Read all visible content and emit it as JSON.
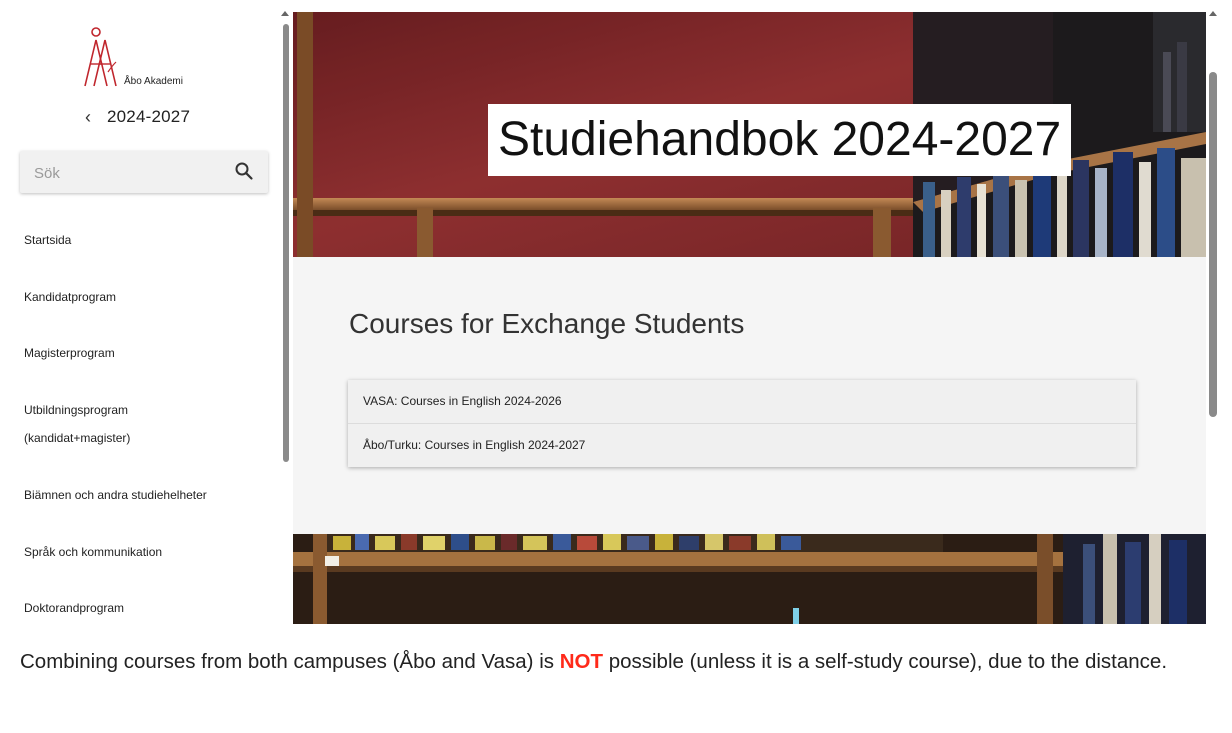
{
  "sidebar": {
    "logo_text": "Åbo Akademi",
    "year": "2024-2027",
    "search_placeholder": "Sök",
    "items": [
      {
        "label": "Startsida"
      },
      {
        "label": "Kandidatprogram"
      },
      {
        "label": "Magisterprogram"
      },
      {
        "label": "Utbildningsprogram"
      },
      {
        "label": "(kandidat+magister)"
      },
      {
        "label": "Biämnen och andra studiehelheter"
      },
      {
        "label": "Språk och kommunikation"
      },
      {
        "label": "Doktorandprogram"
      }
    ]
  },
  "main": {
    "hero_title": "Studiehandbok 2024-2027",
    "section_title": "Courses for Exchange Students",
    "course_links": [
      {
        "label": "VASA: Courses in English 2024-2026"
      },
      {
        "label": "Åbo/Turku: Courses in English 2024-2027"
      }
    ]
  },
  "caption": {
    "before": "Combining courses from both campuses (Åbo and Vasa) is ",
    "emphasis": "NOT",
    "after": " possible (unless it is a self-study course), due to the distance."
  },
  "colors": {
    "brand": "#c0262d",
    "emphasis": "#ff2a1a",
    "hero_wall": "#8e2b2c"
  },
  "icons": [
    "logo-icon",
    "chevron-left-icon",
    "search-icon"
  ]
}
